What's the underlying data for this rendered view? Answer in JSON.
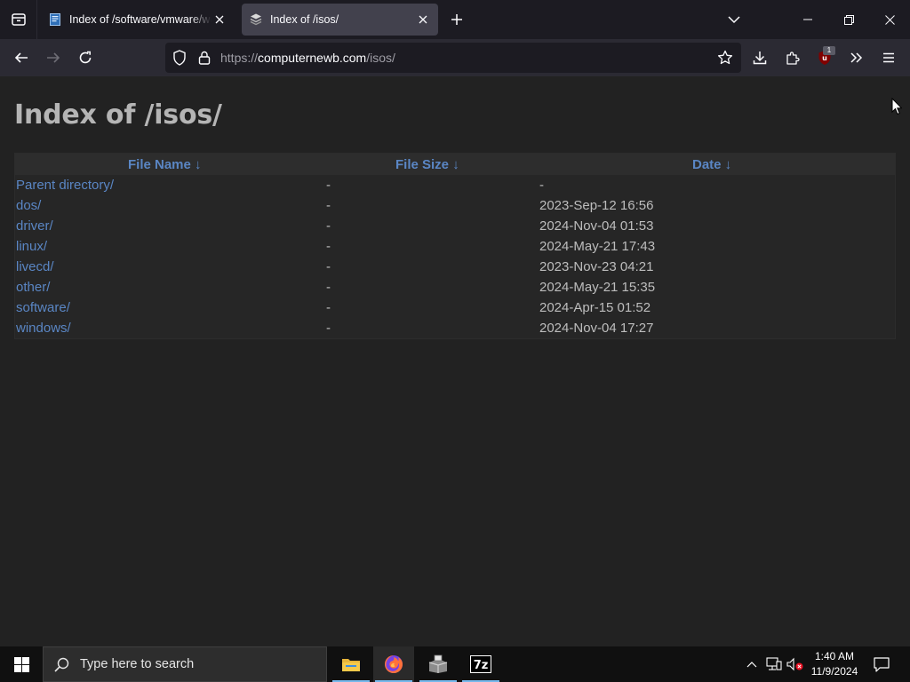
{
  "browser": {
    "tabs": [
      {
        "title": "Index of /software/vmware/wo",
        "active": false
      },
      {
        "title": "Index of /isos/",
        "active": true
      }
    ],
    "url_scheme": "https://",
    "url_host": "computernewb.com",
    "url_path": "/isos/",
    "extension_badge": "1"
  },
  "page": {
    "title": "Index of /isos/",
    "columns": [
      {
        "label": "File Name  ↓"
      },
      {
        "label": "File Size  ↓"
      },
      {
        "label": "Date  ↓"
      }
    ],
    "rows": [
      {
        "name": "Parent directory/",
        "size": "-",
        "date": "-"
      },
      {
        "name": "dos/",
        "size": "-",
        "date": "2023-Sep-12 16:56"
      },
      {
        "name": "driver/",
        "size": "-",
        "date": "2024-Nov-04 01:53"
      },
      {
        "name": "linux/",
        "size": "-",
        "date": "2024-May-21 17:43"
      },
      {
        "name": "livecd/",
        "size": "-",
        "date": "2023-Nov-23 04:21"
      },
      {
        "name": "other/",
        "size": "-",
        "date": "2024-May-21 15:35"
      },
      {
        "name": "software/",
        "size": "-",
        "date": "2024-Apr-15 01:52"
      },
      {
        "name": "windows/",
        "size": "-",
        "date": "2024-Nov-04 17:27"
      }
    ]
  },
  "taskbar": {
    "search_placeholder": "Type here to search",
    "apps": [
      "file-explorer-icon",
      "firefox-icon",
      "installer-icon",
      "7zip-icon"
    ],
    "sevenzip_label": "7z",
    "clock_time": "1:40 AM",
    "clock_date": "11/9/2024"
  },
  "colors": {
    "link": "#5a86c4",
    "page_bg": "#222222",
    "chrome_bg": "#1c1b22",
    "toolbar_bg": "#2b2a33",
    "active_tab": "#42414d",
    "taskbar_underline": "#76b9ed"
  }
}
